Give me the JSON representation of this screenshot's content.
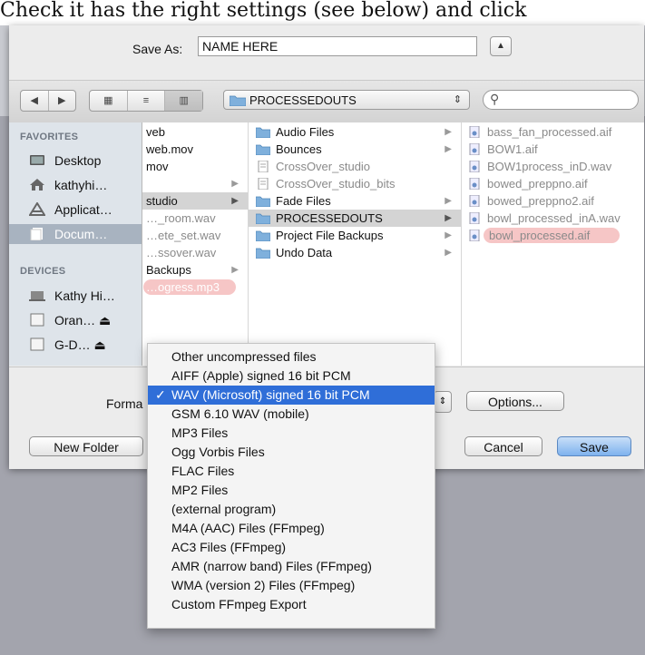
{
  "caption": {
    "text": "Check it has the right settings (see below) and click"
  },
  "save_as": {
    "label": "Save As:",
    "value": "NAME HERE"
  },
  "toolbar": {
    "path_popup_label": "PROCESSEDOUTS",
    "search_placeholder": ""
  },
  "sidebar": {
    "favorites_header": "FAVORITES",
    "devices_header": "DEVICES",
    "favorites": [
      {
        "label": "Desktop",
        "icon": "desktop-icon"
      },
      {
        "label": "kathyhi…",
        "icon": "home-icon"
      },
      {
        "label": "Applicat…",
        "icon": "applications-icon"
      },
      {
        "label": "Docum…",
        "icon": "documents-icon",
        "selected": true
      }
    ],
    "devices": [
      {
        "label": "Kathy Hi…",
        "icon": "laptop-icon"
      },
      {
        "label": "Oran… ⏏",
        "icon": "drive-icon"
      },
      {
        "label": "G-D… ⏏",
        "icon": "drive-icon"
      }
    ]
  },
  "col1": {
    "items": [
      {
        "label": "veb"
      },
      {
        "label": "web.mov"
      },
      {
        "label": "mov"
      },
      {
        "label": ""
      },
      {
        "label": "studio",
        "selected": true
      },
      {
        "label": "…_room.wav"
      },
      {
        "label": "…ete_set.wav"
      },
      {
        "label": "…ssover.wav"
      },
      {
        "label": "Backups"
      },
      {
        "label": "…ogress.mp3",
        "highlight": true
      }
    ]
  },
  "col2": {
    "items": [
      {
        "label": "Audio Files",
        "type": "folder"
      },
      {
        "label": "Bounces",
        "type": "folder"
      },
      {
        "label": "CrossOver_studio",
        "type": "doc"
      },
      {
        "label": "CrossOver_studio_bits",
        "type": "doc"
      },
      {
        "label": "Fade Files",
        "type": "folder"
      },
      {
        "label": "PROCESSEDOUTS",
        "type": "folder",
        "selected": true
      },
      {
        "label": "Project File Backups",
        "type": "folder"
      },
      {
        "label": "Undo Data",
        "type": "folder"
      }
    ]
  },
  "col3": {
    "items": [
      {
        "label": "bass_fan_processed.aif"
      },
      {
        "label": "BOW1.aif"
      },
      {
        "label": "BOW1process_inD.wav"
      },
      {
        "label": "bowed_preppno.aif"
      },
      {
        "label": "bowed_preppno2.aif"
      },
      {
        "label": "bowl_processed_inA.wav"
      },
      {
        "label": "bowl_processed.aif",
        "highlight": true
      }
    ]
  },
  "bottom": {
    "format_label": "Forma",
    "options_label": "Options...",
    "new_folder_label": "New Folder",
    "cancel_label": "Cancel",
    "save_label": "Save"
  },
  "format_menu": {
    "items": [
      "Other uncompressed files",
      "AIFF (Apple) signed 16 bit PCM",
      "WAV (Microsoft) signed 16 bit PCM",
      "GSM 6.10 WAV (mobile)",
      "MP3 Files",
      "Ogg Vorbis Files",
      "FLAC Files",
      "MP2 Files",
      "(external program)",
      "M4A (AAC) Files (FFmpeg)",
      "AC3 Files (FFmpeg)",
      "AMR (narrow band) Files (FFmpeg)",
      "WMA (version 2) Files (FFmpeg)",
      "Custom FFmpeg Export"
    ],
    "selected_index": 2,
    "check_mark": "✓"
  },
  "colors": {
    "selection_blue": "#2f6ed8",
    "highlight_pink": "#f6c6c6",
    "sidebar_bg": "#dee4ea",
    "folder_blue": "#7fb0dc"
  }
}
